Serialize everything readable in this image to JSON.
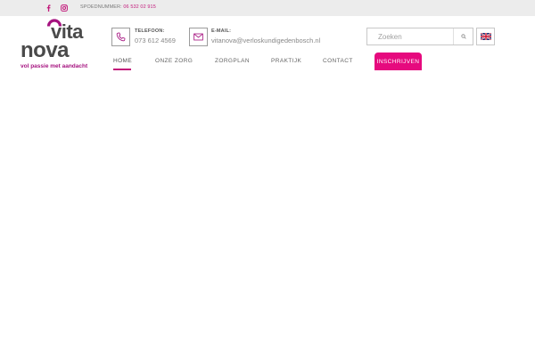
{
  "topbar": {
    "emergency_label": "SPOEDNUMMER:",
    "emergency_number": "06 532 02 915",
    "social": [
      "facebook-icon",
      "instagram-icon"
    ]
  },
  "logo": {
    "line1": "vita",
    "line2": "nova",
    "tagline": "vol passie met aandacht",
    "colors": {
      "text": "#4a4a4a",
      "accent": "#a5127f"
    }
  },
  "contact": {
    "phone": {
      "label": "TELEFOON:",
      "value": "073 612 4569",
      "icon": "phone-icon"
    },
    "email": {
      "label": "E-MAIL:",
      "value": "vitanova@verloskundigedenbosch.nl",
      "icon": "mail-icon"
    }
  },
  "search": {
    "placeholder": "Zoeken",
    "icon": "search-icon"
  },
  "language": {
    "icon": "uk-flag-icon"
  },
  "nav": {
    "items": [
      "HOME",
      "ONZE ZORG",
      "ZORGPLAN",
      "PRAKTIJK",
      "CONTACT"
    ],
    "active": "HOME",
    "cta": "INSCHRIJVEN"
  },
  "colors": {
    "brand": "#c2187a",
    "cta": "#e60a7e",
    "topbar": "#ececec"
  }
}
